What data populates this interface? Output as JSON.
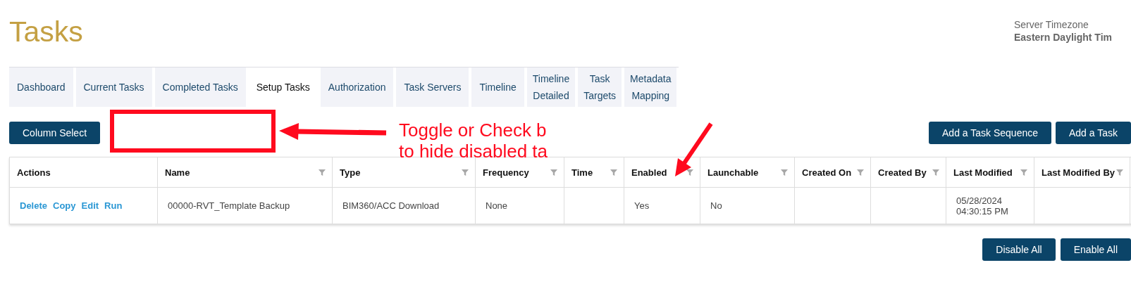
{
  "page_title": "Tasks",
  "server_timezone": {
    "label": "Server Timezone",
    "value": "Eastern Daylight Tim"
  },
  "tabs": [
    {
      "label": "Dashboard",
      "selected": false,
      "wrap": false
    },
    {
      "label": "Current Tasks",
      "selected": false,
      "wrap": false
    },
    {
      "label": "Completed Tasks",
      "selected": false,
      "wrap": false
    },
    {
      "label": "Setup Tasks",
      "selected": true,
      "wrap": false
    },
    {
      "label": "Authorization",
      "selected": false,
      "wrap": false
    },
    {
      "label": "Task Servers",
      "selected": false,
      "wrap": false
    },
    {
      "label": "Timeline",
      "selected": false,
      "wrap": false
    },
    {
      "label": "Timeline Detailed",
      "selected": false,
      "wrap": true
    },
    {
      "label": "Task Targets",
      "selected": false,
      "wrap": true
    },
    {
      "label": "Metadata Mapping",
      "selected": false,
      "wrap": true
    }
  ],
  "toolbar": {
    "left_buttons": [
      "Column Select"
    ],
    "right_buttons": [
      "Add a Task Sequence",
      "Add a Task"
    ]
  },
  "callout": {
    "lines": [
      "Toggle or Check b",
      "to hide disabled ta"
    ]
  },
  "table": {
    "columns": [
      {
        "label": "Actions",
        "filterable": false
      },
      {
        "label": "Name",
        "filterable": true
      },
      {
        "label": "Type",
        "filterable": true
      },
      {
        "label": "Frequency",
        "filterable": true
      },
      {
        "label": "Time",
        "filterable": true
      },
      {
        "label": "Enabled",
        "filterable": true
      },
      {
        "label": "Launchable",
        "filterable": true
      },
      {
        "label": "Created On",
        "filterable": true
      },
      {
        "label": "Created By",
        "filterable": true
      },
      {
        "label": "Last Modified",
        "filterable": true
      },
      {
        "label": "Last Modified By",
        "filterable": true
      }
    ],
    "rows": [
      {
        "cells": [
          {
            "actions": [
              "Delete",
              "Copy",
              "Edit",
              "Run"
            ]
          },
          "00000-RVT_Template Backup",
          "BIM360/ACC Download",
          "None",
          "",
          "Yes",
          "No",
          "",
          "",
          "05/28/2024 04:30:15 PM",
          ""
        ]
      }
    ]
  },
  "footer_buttons": [
    "Disable All",
    "Enable All"
  ]
}
